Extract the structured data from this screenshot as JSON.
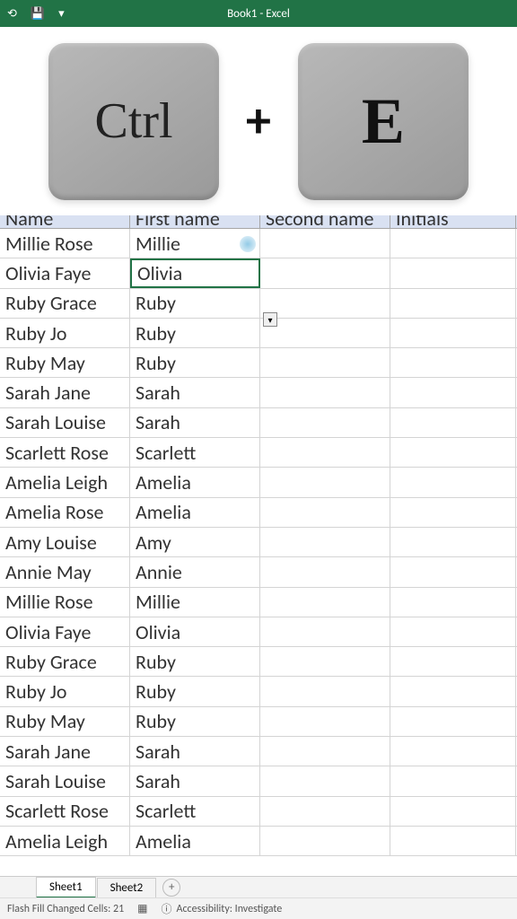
{
  "title_bar": {
    "title": "Book1 - Excel"
  },
  "overlay": {
    "key1": "Ctrl",
    "plus": "+",
    "key2": "E"
  },
  "headers": [
    "Name",
    "First name",
    "Second name",
    "Initials"
  ],
  "rows": [
    {
      "name": "Millie Rose",
      "first": "Millie",
      "second": "",
      "initials": ""
    },
    {
      "name": "Olivia Faye",
      "first": "Olivia",
      "second": "",
      "initials": ""
    },
    {
      "name": "Ruby Grace",
      "first": "Ruby",
      "second": "",
      "initials": ""
    },
    {
      "name": "Ruby Jo",
      "first": "Ruby",
      "second": "",
      "initials": ""
    },
    {
      "name": "Ruby May",
      "first": "Ruby",
      "second": "",
      "initials": ""
    },
    {
      "name": "Sarah Jane",
      "first": "Sarah",
      "second": "",
      "initials": ""
    },
    {
      "name": "Sarah Louise",
      "first": "Sarah",
      "second": "",
      "initials": ""
    },
    {
      "name": "Scarlett Rose",
      "first": "Scarlett",
      "second": "",
      "initials": ""
    },
    {
      "name": "Amelia Leigh",
      "first": "Amelia",
      "second": "",
      "initials": ""
    },
    {
      "name": "Amelia Rose",
      "first": "Amelia",
      "second": "",
      "initials": ""
    },
    {
      "name": "Amy Louise",
      "first": "Amy",
      "second": "",
      "initials": ""
    },
    {
      "name": "Annie May",
      "first": "Annie",
      "second": "",
      "initials": ""
    },
    {
      "name": "Millie Rose",
      "first": "Millie",
      "second": "",
      "initials": ""
    },
    {
      "name": "Olivia Faye",
      "first": "Olivia",
      "second": "",
      "initials": ""
    },
    {
      "name": "Ruby Grace",
      "first": "Ruby",
      "second": "",
      "initials": ""
    },
    {
      "name": "Ruby Jo",
      "first": "Ruby",
      "second": "",
      "initials": ""
    },
    {
      "name": "Ruby May",
      "first": "Ruby",
      "second": "",
      "initials": ""
    },
    {
      "name": "Sarah Jane",
      "first": "Sarah",
      "second": "",
      "initials": ""
    },
    {
      "name": "Sarah Louise",
      "first": "Sarah",
      "second": "",
      "initials": ""
    },
    {
      "name": "Scarlett Rose",
      "first": "Scarlett",
      "second": "",
      "initials": ""
    },
    {
      "name": "Amelia Leigh",
      "first": "Amelia",
      "second": "",
      "initials": ""
    }
  ],
  "selected_row_index": 1,
  "cursor_row_index": 0,
  "sheets": {
    "tabs": [
      "Sheet1",
      "Sheet2"
    ],
    "active_index": 0,
    "add_label": "+"
  },
  "status_bar": {
    "flash_fill": "Flash Fill Changed Cells: 21",
    "accessibility": "Accessibility: Investigate"
  },
  "flash_fill_smart_tag": "▾"
}
